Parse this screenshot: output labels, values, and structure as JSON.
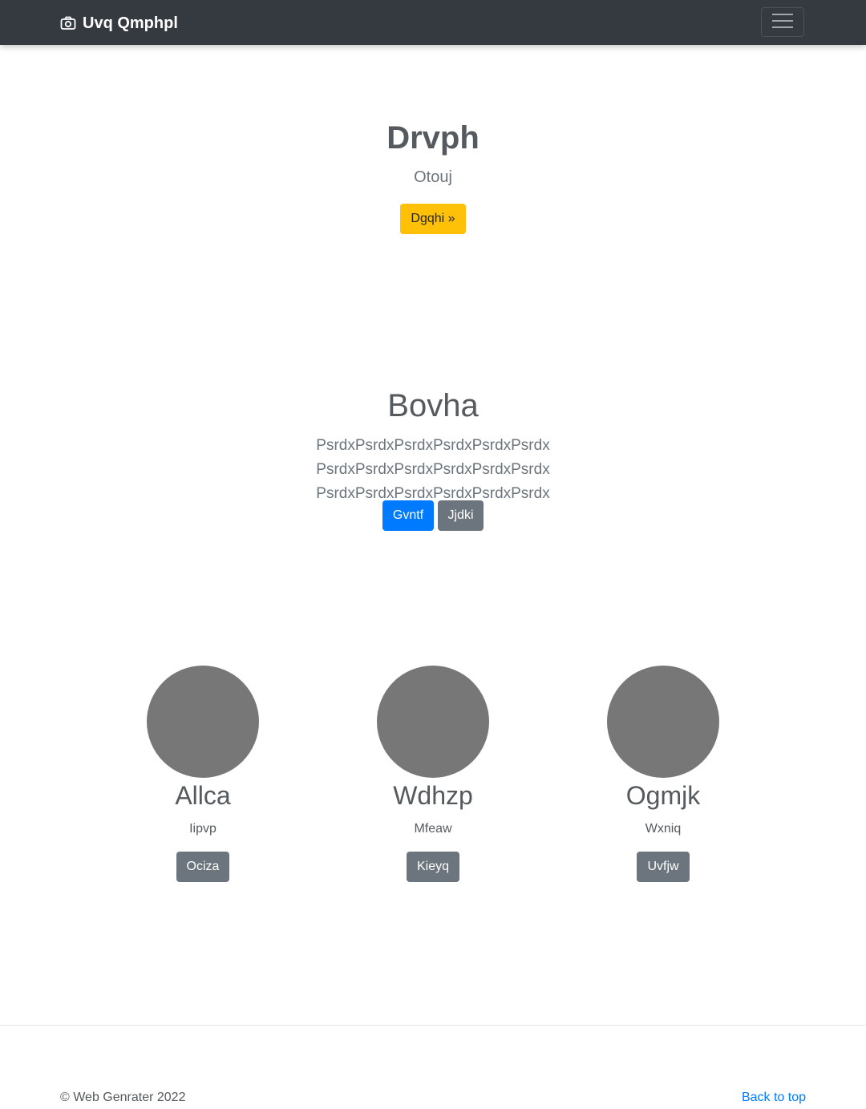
{
  "navbar": {
    "brand": "Uvq Qmphpl",
    "brand_icon": "camera-icon",
    "toggler_icon": "hamburger-menu-icon"
  },
  "hero": {
    "title": "Drvph",
    "subtitle": "Otouj",
    "button_label": "Dgqhi »"
  },
  "section": {
    "title": "Bovha",
    "lead": "PsrdxPsrdxPsrdxPsrdxPsrdxPsrdx PsrdxPsrdxPsrdxPsrdxPsrdxPsrdx PsrdxPsrdxPsrdxPsrdxPsrdxPsrdx",
    "primary_button": "Gvntf",
    "secondary_button": "Jjdki"
  },
  "columns": [
    {
      "heading": "Allca",
      "text": "Iipvp",
      "button": "Ociza"
    },
    {
      "heading": "Wdhzp",
      "text": "Mfeaw",
      "button": "Kieyq"
    },
    {
      "heading": "Ogmjk",
      "text": "Wxniq",
      "button": "Uvfjw"
    }
  ],
  "footer": {
    "copyright": "© Web Genrater 2022",
    "back_to_top": "Back to top"
  },
  "colors": {
    "navbar_bg": "#343a40",
    "warning": "#ffc107",
    "primary": "#007bff",
    "secondary": "#6c757d",
    "avatar": "#777777"
  }
}
